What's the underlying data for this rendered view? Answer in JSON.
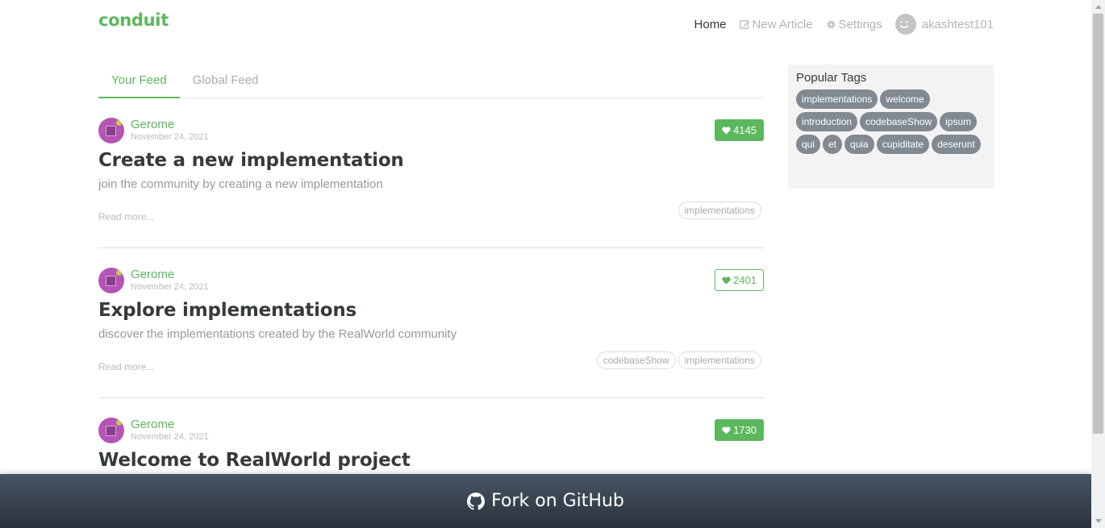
{
  "navbar": {
    "brand": "conduit",
    "items": [
      {
        "label": "Home",
        "icon": "",
        "active": true
      },
      {
        "label": "New Article",
        "icon": "edit-icon",
        "active": false
      },
      {
        "label": "Settings",
        "icon": "gear-icon",
        "active": false
      }
    ],
    "username": "akashtest101"
  },
  "feed_tabs": [
    {
      "label": "Your Feed",
      "active": true
    },
    {
      "label": "Global Feed",
      "active": false
    }
  ],
  "articles": [
    {
      "author": "Gerome",
      "date": "November 24, 2021",
      "likes": "4145",
      "liked": true,
      "title": "Create a new implementation",
      "description": "join the community by creating a new implementation",
      "read_more": "Read more...",
      "tags": [
        "implementations"
      ]
    },
    {
      "author": "Gerome",
      "date": "November 24, 2021",
      "likes": "2401",
      "liked": false,
      "title": "Explore implementations",
      "description": "discover the implementations created by the RealWorld community",
      "read_more": "Read more...",
      "tags": [
        "codebaseShow",
        "implementations"
      ]
    },
    {
      "author": "Gerome",
      "date": "November 24, 2021",
      "likes": "1730",
      "liked": true,
      "title": "Welcome to RealWorld project",
      "description": "",
      "read_more": "",
      "tags": []
    }
  ],
  "sidebar": {
    "title": "Popular Tags",
    "tags": [
      "implementations",
      "welcome",
      "introduction",
      "codebaseShow",
      "ipsum",
      "qui",
      "et",
      "quia",
      "cupiditate",
      "deserunt"
    ]
  },
  "footer": {
    "label": "Fork on GitHub"
  },
  "colors": {
    "accent": "#5cb85c",
    "tag_pill": "#818a91",
    "footer_top": "#485563",
    "footer_bottom": "#29323c"
  }
}
